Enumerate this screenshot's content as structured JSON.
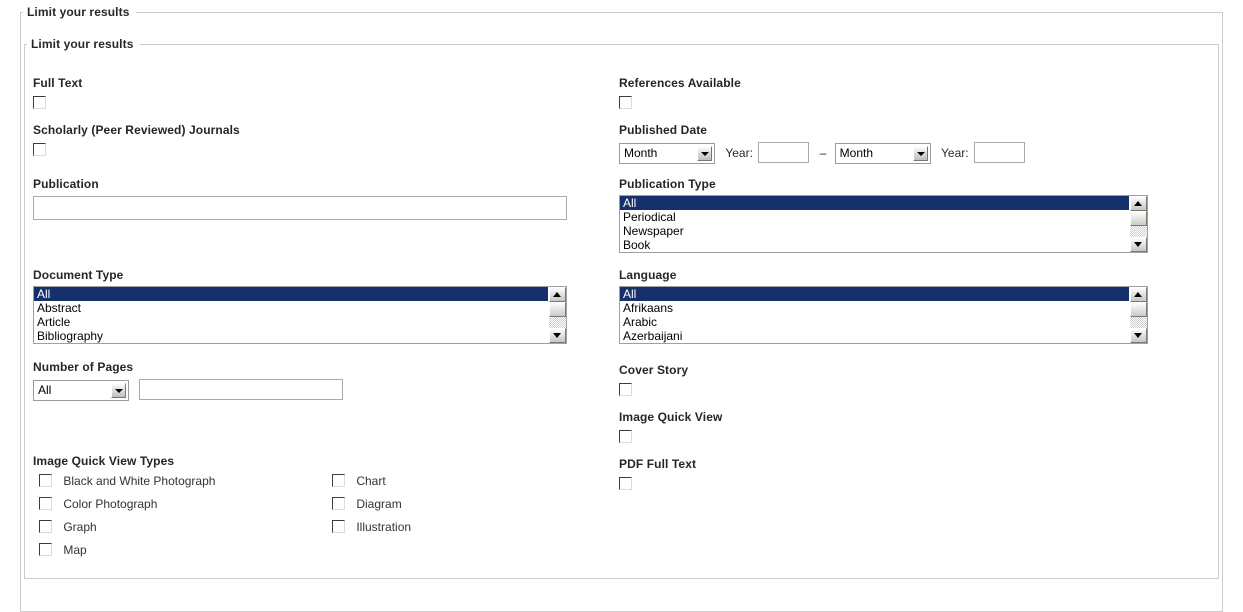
{
  "outer_fieldset": {
    "legend": "Limit your results"
  },
  "inner_fieldset": {
    "legend": "Limit your results"
  },
  "colors": {
    "selection_highlight": "#16306b",
    "fieldset_border": "#cccccc",
    "listbox_border": "#a0a0a0",
    "input_border": "#a9a9a9",
    "label_text": "#262626"
  },
  "left_column": {
    "full_text": {
      "label": "Full Text",
      "checked": false
    },
    "scholarly": {
      "label": "Scholarly (Peer Reviewed) Journals",
      "checked": false
    },
    "publication": {
      "label": "Publication",
      "value": "",
      "placeholder": ""
    },
    "document_type": {
      "label": "Document Type",
      "options": [
        "All",
        "Abstract",
        "Article",
        "Bibliography"
      ],
      "selected": "All"
    },
    "number_of_pages": {
      "label": "Number of Pages",
      "select_value": "All",
      "text_value": "",
      "text_placeholder": ""
    },
    "image_quick_view_types": {
      "label": "Image Quick View Types",
      "column_one": [
        {
          "label": "Black and White Photograph",
          "checked": false
        },
        {
          "label": "Color Photograph",
          "checked": false
        },
        {
          "label": "Graph",
          "checked": false
        },
        {
          "label": "Map",
          "checked": false
        }
      ],
      "column_two": [
        {
          "label": "Chart",
          "checked": false
        },
        {
          "label": "Diagram",
          "checked": false
        },
        {
          "label": "Illustration",
          "checked": false
        }
      ]
    }
  },
  "right_column": {
    "references_available": {
      "label": "References Available",
      "checked": false
    },
    "published_date": {
      "label": "Published Date",
      "from_month_value": "Month",
      "from_year_label": "Year:",
      "from_year_value": "",
      "separator": "–",
      "to_month_value": "Month",
      "to_year_label": "Year:",
      "to_year_value": ""
    },
    "publication_type": {
      "label": "Publication Type",
      "options": [
        "All",
        "Periodical",
        "Newspaper",
        "Book"
      ],
      "selected": "All"
    },
    "language": {
      "label": "Language",
      "options": [
        "All",
        "Afrikaans",
        "Arabic",
        "Azerbaijani"
      ],
      "selected": "All"
    },
    "cover_story": {
      "label": "Cover Story",
      "checked": false
    },
    "image_quick_view": {
      "label": "Image Quick View",
      "checked": false
    },
    "pdf_full_text": {
      "label": "PDF Full Text",
      "checked": false
    }
  }
}
